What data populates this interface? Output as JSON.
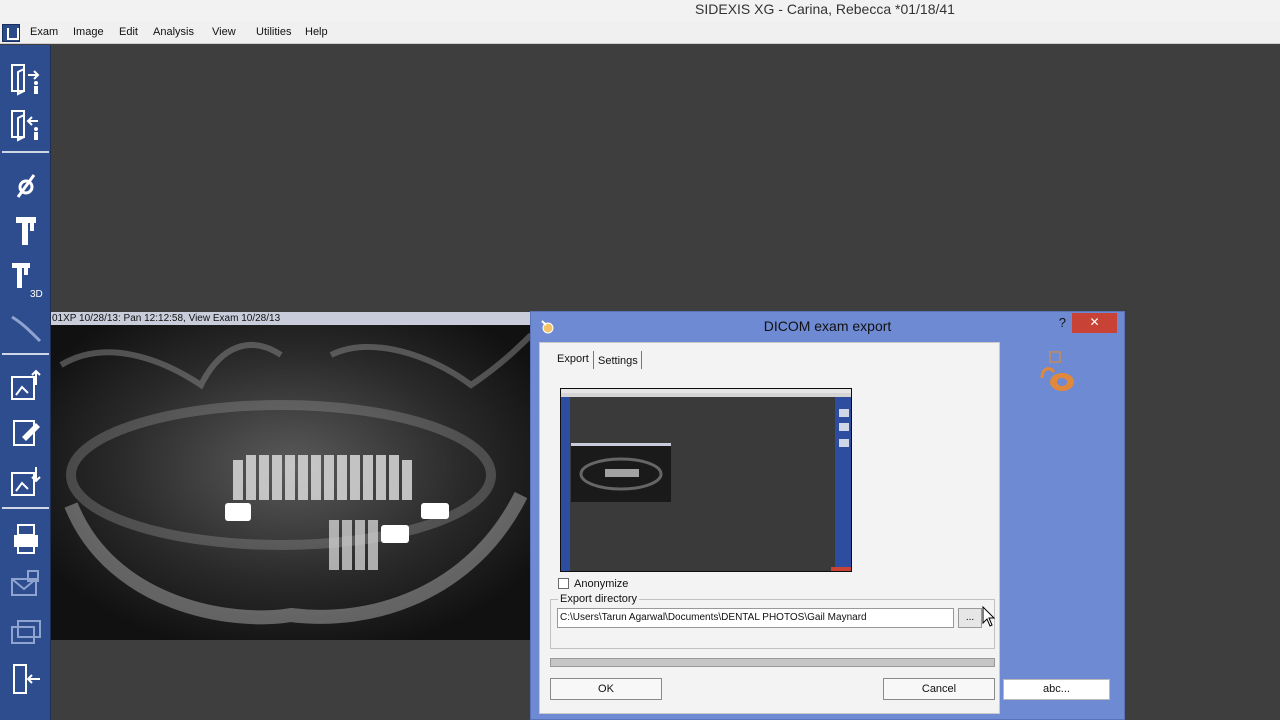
{
  "window": {
    "title": "SIDEXIS XG - Carina, Rebecca *01/18/41"
  },
  "menu": {
    "items": [
      "Exam",
      "Image",
      "Edit",
      "Analysis",
      "View",
      "Utilities",
      "Help"
    ]
  },
  "sidebar": {
    "icons": [
      "exam-enter-icon",
      "exam-exit-icon",
      "ceph-icon",
      "pan-unit-icon",
      "pan-3d-icon",
      "intraoral-sensor-icon",
      "image-import-icon",
      "image-edit-icon",
      "image-export-icon",
      "print-icon",
      "mail-icon",
      "window-icon",
      "exit-icon"
    ],
    "label_3d": "3D"
  },
  "xray": {
    "caption": "01XP 10/28/13: Pan 12:12:58, View Exam 10/28/13"
  },
  "dialog": {
    "title": "DICOM exam export",
    "help_label": "?",
    "close_label": "✕",
    "tabs": [
      "Export",
      "Settings"
    ],
    "active_tab": "Export",
    "anonymize_label": "Anonymize",
    "anonymize_checked": false,
    "export_directory_label": "Export directory",
    "export_path": "C:\\Users\\Tarun Agarwal\\Documents\\DENTAL PHOTOS\\Gail Maynard",
    "browse_label": "...",
    "ok_label": "OK",
    "cancel_label": "Cancel",
    "abc_label": "abc..."
  },
  "colors": {
    "sidebar": "#2e4d8e",
    "dialog_frame": "#6d8ad3",
    "close_button": "#c94236",
    "workspace": "#3e3e3e",
    "accent_icon": "#e0883b"
  }
}
